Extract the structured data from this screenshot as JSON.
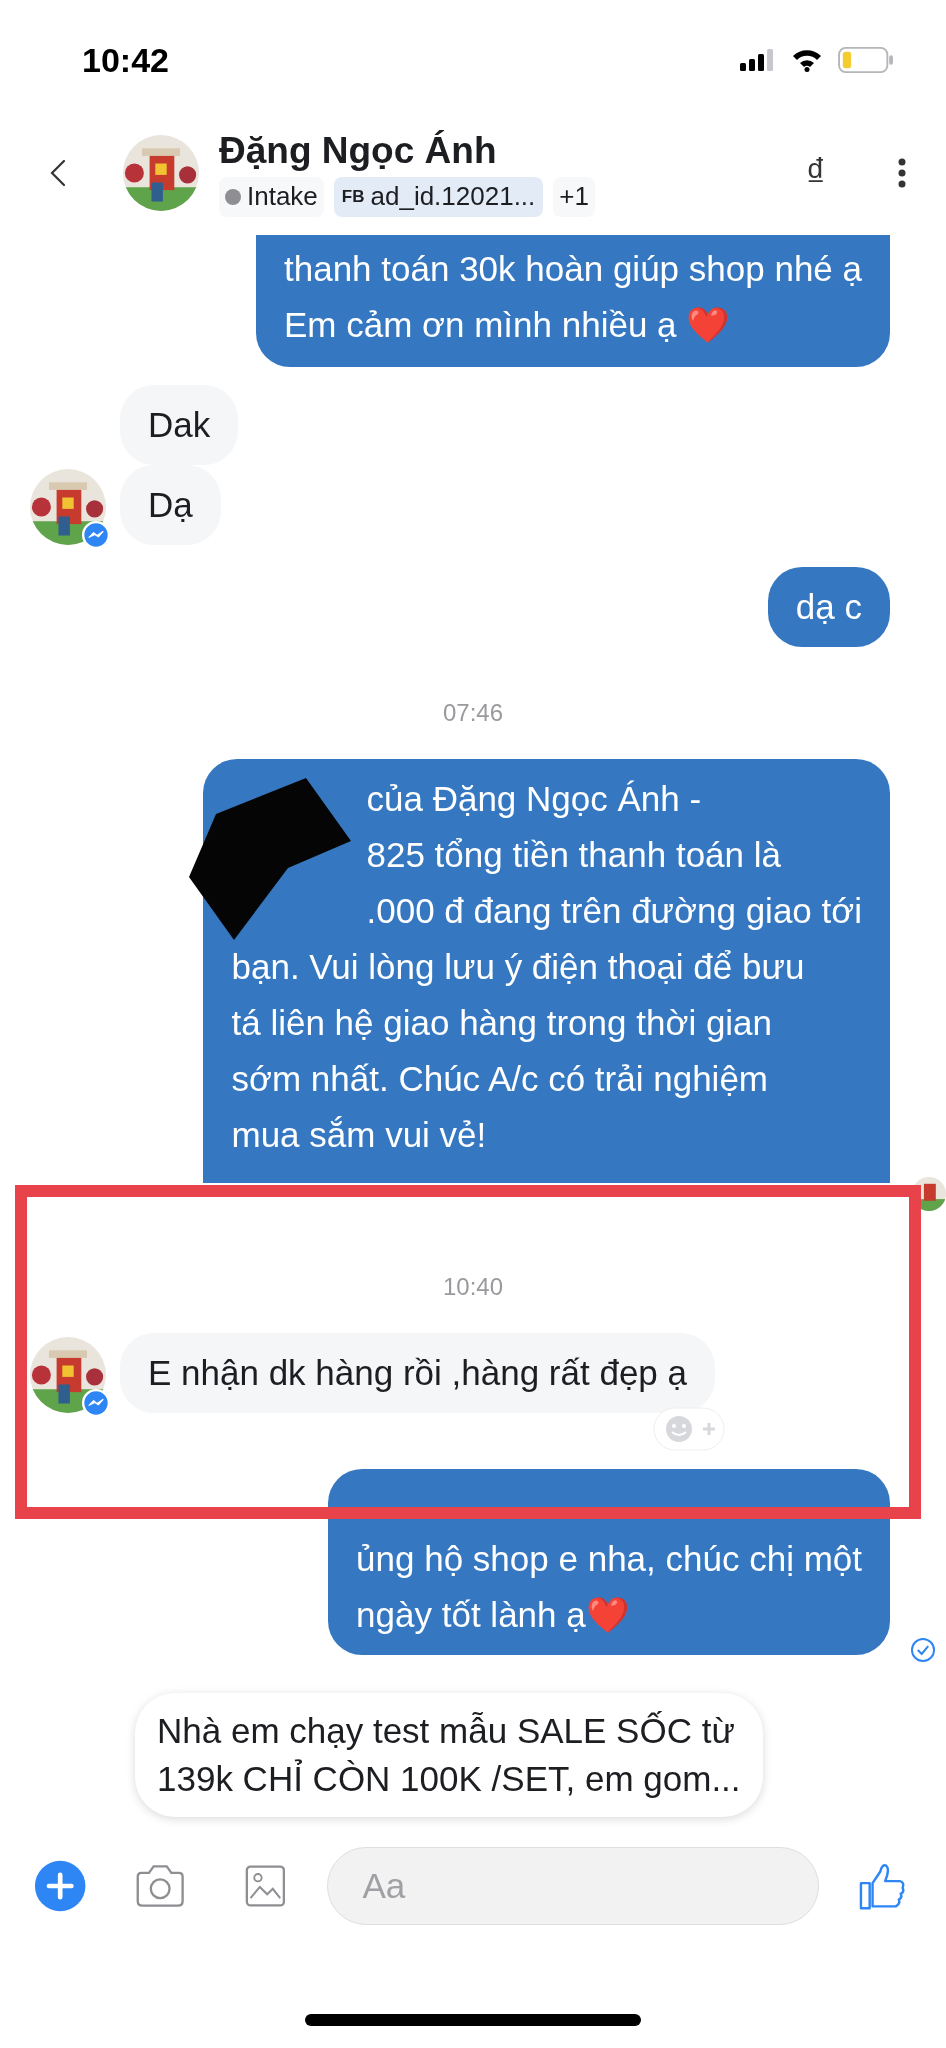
{
  "status_bar": {
    "time": "10:42"
  },
  "header": {
    "name": "Đặng Ngọc Ánh",
    "currency": "₫",
    "tags": [
      {
        "kind": "status",
        "label": "Intake",
        "color": "#8e8e93"
      },
      {
        "kind": "source",
        "prefix": "FB",
        "label": "ad_id.12021..."
      },
      {
        "kind": "more",
        "label": "+1"
      }
    ]
  },
  "messages": [
    {
      "kind": "sent",
      "cut_top": true,
      "lines": [
        {
          "text": "thanh toán 30k hoàn giúp shop nhé ạ",
          "redacted": false
        },
        {
          "text": "Em cảm ơn mình nhiều ạ ❤️",
          "redacted": false
        }
      ]
    },
    {
      "kind": "received",
      "show_avatar": false,
      "text": "Dak"
    },
    {
      "kind": "received",
      "show_avatar": true,
      "text": "Dạ"
    },
    {
      "kind": "sent",
      "cut_top": false,
      "lines": [
        {
          "text": "dạ c",
          "redacted": false
        }
      ]
    },
    {
      "kind": "time",
      "text": "07:46"
    },
    {
      "kind": "sent",
      "cut_top": false,
      "read_avatar": true,
      "lines": [
        {
          "text": "của Đặng Ngọc Ánh -",
          "redacted": true
        },
        {
          "text": "825 tổng tiền thanh toán là",
          "redacted": true
        },
        {
          "text": ".000 đ đang trên đường giao tới",
          "redacted": true
        },
        {
          "text": "bạn. Vui lòng lưu ý điện thoại để bưu",
          "redacted": false
        },
        {
          "text": "tá liên hệ giao hàng trong thời gian",
          "redacted": false
        },
        {
          "text": "sớm nhất. Chúc A/c có trải nghiệm",
          "redacted": false
        },
        {
          "text": "mua sắm vui vẻ!",
          "redacted": false
        }
      ]
    },
    {
      "kind": "time",
      "text": "10:40"
    },
    {
      "kind": "received",
      "show_avatar": true,
      "reaction_button": true,
      "text": "E nhận dk hàng rồi ,hàng rất đẹp ạ"
    },
    {
      "kind": "sent",
      "cut_top": false,
      "covered_top": true,
      "seen": true,
      "lines": [
        {
          "text": "ủng hộ shop e nha, chúc chị một",
          "redacted": false
        },
        {
          "text": "ngày tốt lành ạ❤️",
          "redacted": false
        }
      ]
    }
  ],
  "quick_reply": {
    "text": "Nhà em chạy test mẫu SALE SỐC từ\n139k CHỈ CÒN 100K /SET, em gom..."
  },
  "composer": {
    "placeholder": "Aa"
  }
}
